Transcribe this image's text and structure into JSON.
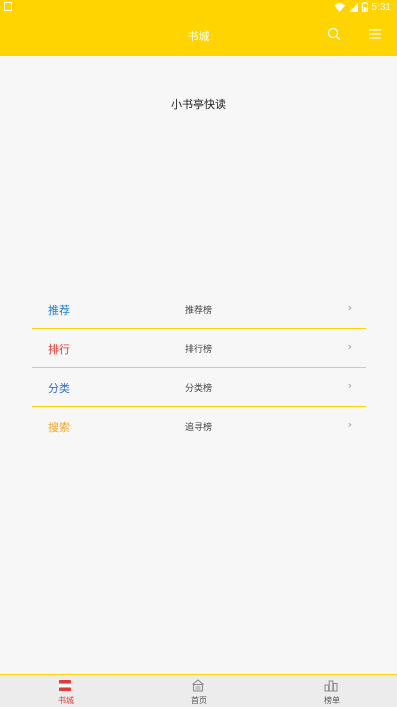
{
  "status_bar": {
    "time": "5:31"
  },
  "header": {
    "title": "书城",
    "search_icon": "search-icon",
    "menu_icon": "hamburger-menu-icon"
  },
  "slogan": "小书亭快读",
  "menu": [
    {
      "label": "推荐",
      "sub": "推荐榜",
      "color": "#1a7fd4"
    },
    {
      "label": "排行",
      "sub": "排行榜",
      "color": "#e53935"
    },
    {
      "label": "分类",
      "sub": "分类榜",
      "color": "#2a6fd6"
    },
    {
      "label": "搜索",
      "sub": "追寻榜",
      "color": "#f5a623"
    }
  ],
  "bottom_nav": [
    {
      "label": "书城",
      "icon": "books-icon",
      "active": true
    },
    {
      "label": "首页",
      "icon": "home-icon",
      "active": false
    },
    {
      "label": "榜单",
      "icon": "ranking-icon",
      "active": false
    }
  ],
  "colors": {
    "accent": "#ffd400",
    "active_tab": "#e53935",
    "inactive_tab": "#888888"
  }
}
